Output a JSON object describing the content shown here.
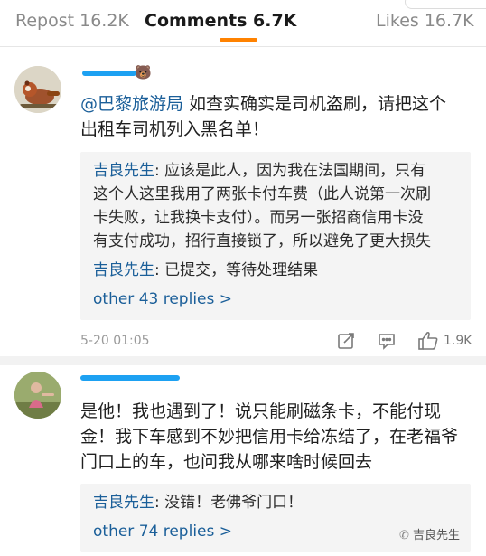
{
  "tabs": {
    "repost": "Repost 16.2K",
    "comments": "Comments 6.7K",
    "likes": "Likes 16.7K"
  },
  "comments": [
    {
      "mention": "@巴黎旅游局",
      "text_line1": " 如查实确实是司机盗刷，请把这个",
      "text_line2": "出租车司机列入黑名单！",
      "badge_icon": "🐻",
      "replies": [
        {
          "author": "吉良先生",
          "lines": [
            ": 应该是此人，因为我在法国期间，只有",
            "这个人这里我用了两张卡付车费（此人说第一次刷",
            "卡失败，让我换卡支付）。而另一张招商信用卡没",
            "有支付成功，招行直接锁了，所以避免了更大损失"
          ]
        },
        {
          "author": "吉良先生",
          "lines": [
            ": 已提交，等待处理结果"
          ]
        }
      ],
      "more_replies": "other 43 replies >",
      "timestamp": "5-20 01:05",
      "likes": "1.9K"
    },
    {
      "text_lines": [
        "是他！我也遇到了！说只能刷磁条卡，不能付现",
        "金！我下车感到不妙把信用卡给冻结了，在老福爷",
        "门口上的车，也问我从哪来啥时候回去"
      ],
      "replies": [
        {
          "author": "吉良先生",
          "lines": [
            ": 没错！老佛爷门口！"
          ]
        }
      ],
      "more_replies": "other 74 replies >"
    }
  ],
  "watermark": "吉良先生",
  "colors": {
    "link": "#1b5f99",
    "tab_accent": "#ff8200",
    "username_blur": "#1da1f2"
  }
}
